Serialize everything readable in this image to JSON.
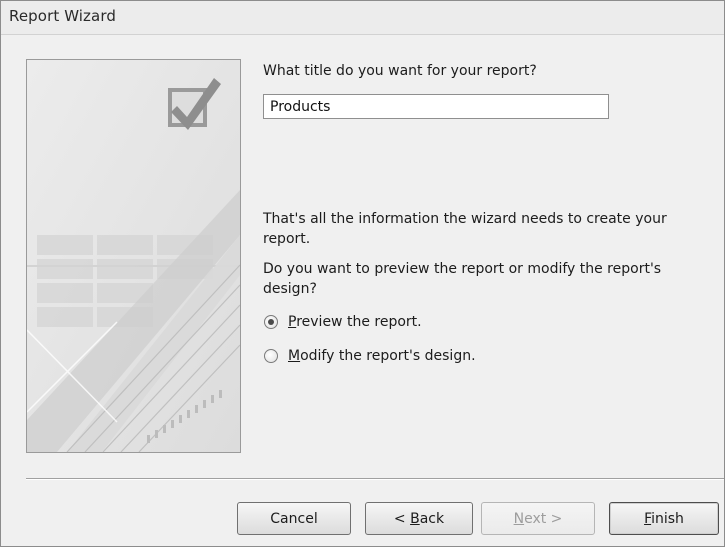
{
  "window": {
    "title": "Report Wizard"
  },
  "main": {
    "title_prompt": "What title do you want for your report?",
    "title_value": "Products",
    "info_line1": "That's all the information the wizard needs to create your",
    "info_line2": "report.",
    "question_line1": "Do you want to preview the report or modify the report's",
    "question_line2": "design?",
    "options": [
      {
        "mnemonic": "P",
        "rest": "review the report.",
        "selected": true
      },
      {
        "mnemonic": "M",
        "rest": "odify the report's design.",
        "selected": false
      }
    ]
  },
  "buttons": {
    "cancel": "Cancel",
    "back_prefix": "< ",
    "back_mnemonic": "B",
    "back_rest": "ack",
    "next_mnemonic": "N",
    "next_rest": "ext >",
    "finish_mnemonic": "F",
    "finish_rest": "inish"
  },
  "icons": {
    "side_image": "wizard-report-illustration",
    "checkmark": "checkbox-checkmark-icon"
  },
  "colors": {
    "window_bg": "#f0f0f0",
    "panel_bg": "#e6e6e6"
  }
}
